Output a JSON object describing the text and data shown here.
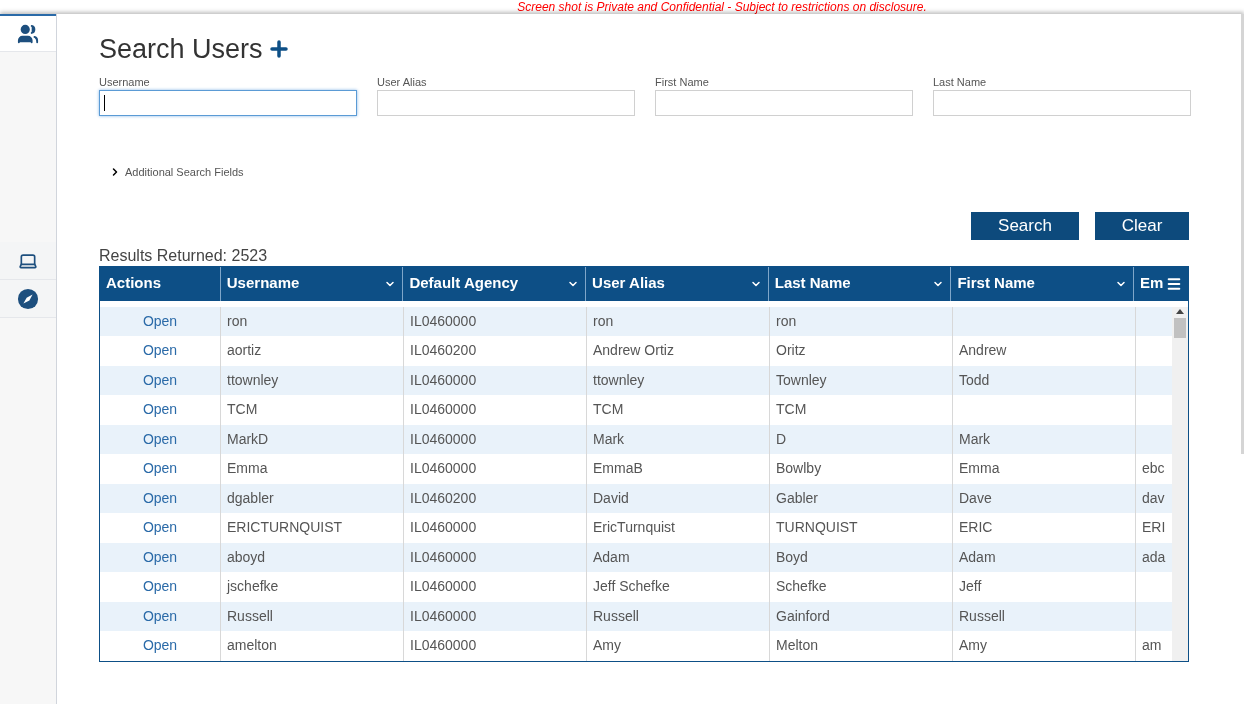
{
  "banner": "Screen shot is Private and Confidential - Subject to restrictions on disclosure.",
  "sidebar": {
    "items": [
      {
        "kind": "users",
        "selected": true
      },
      {
        "kind": "laptop",
        "selected": false
      },
      {
        "kind": "compass",
        "selected": false
      }
    ]
  },
  "title": "Search Users",
  "fields": [
    {
      "label": "Username",
      "focused": true
    },
    {
      "label": "User Alias",
      "focused": false
    },
    {
      "label": "First Name",
      "focused": false
    },
    {
      "label": "Last Name",
      "focused": false
    }
  ],
  "expander": {
    "label": "Additional Search Fields",
    "expanded": false
  },
  "buttons": [
    "Search",
    "Clear"
  ],
  "results": "Results Returned: 2523",
  "table": {
    "columns": [
      {
        "label": "Actions",
        "sortable": false
      },
      {
        "label": "Username",
        "sortable": true
      },
      {
        "label": "Default Agency",
        "sortable": true
      },
      {
        "label": "User Alias",
        "sortable": true
      },
      {
        "label": "Last Name",
        "sortable": true
      },
      {
        "label": "First Name",
        "sortable": true
      },
      {
        "label": "Em",
        "sortable": false
      }
    ],
    "rows": [
      {
        "action": "Open",
        "username": "ron",
        "default_agency": "IL0460000",
        "user_alias": "ron",
        "last_name": "ron"
      },
      {
        "action": "Open",
        "username": "aortiz",
        "default_agency": "IL0460200",
        "user_alias": "Andrew Ortiz",
        "last_name": "Oritz",
        "first_name": "Andrew"
      },
      {
        "action": "Open",
        "username": "ttownley",
        "default_agency": "IL0460000",
        "user_alias": "ttownley",
        "last_name": "Townley",
        "first_name": "Todd"
      },
      {
        "action": "Open",
        "username": "TCM",
        "default_agency": "IL0460000",
        "user_alias": "TCM",
        "last_name": "TCM"
      },
      {
        "action": "Open",
        "username": "MarkD",
        "default_agency": "IL0460000",
        "user_alias": "Mark",
        "last_name": "D",
        "first_name": "Mark"
      },
      {
        "action": "Open",
        "username": "Emma",
        "default_agency": "IL0460000",
        "user_alias": "EmmaB",
        "last_name": "Bowlby",
        "first_name": "Emma",
        "column_7": "ebc"
      },
      {
        "action": "Open",
        "username": "dgabler",
        "default_agency": "IL0460200",
        "user_alias": "David",
        "last_name": "Gabler",
        "first_name": "Dave",
        "column_7": "dav"
      },
      {
        "action": "Open",
        "username": "ERICTURNQUIST",
        "default_agency": "IL0460000",
        "user_alias": "EricTurnquist",
        "last_name": "TURNQUIST",
        "first_name": "ERIC",
        "column_7": "ERI"
      },
      {
        "action": "Open",
        "username": "aboyd",
        "default_agency": "IL0460000",
        "user_alias": "Adam",
        "last_name": "Boyd",
        "first_name": "Adam",
        "column_7": "ada"
      },
      {
        "action": "Open",
        "username": "jschefke",
        "default_agency": "IL0460000",
        "user_alias": "Jeff Schefke",
        "last_name": "Schefke",
        "first_name": "Jeff"
      },
      {
        "action": "Open",
        "username": "Russell",
        "default_agency": "IL0460000",
        "user_alias": "Russell",
        "last_name": "Gainford",
        "first_name": "Russell"
      },
      {
        "action": "Open",
        "username": "amelton",
        "default_agency": "IL0460000",
        "user_alias": "Amy",
        "last_name": "Melton",
        "first_name": "Amy",
        "column_7": "am"
      }
    ]
  }
}
